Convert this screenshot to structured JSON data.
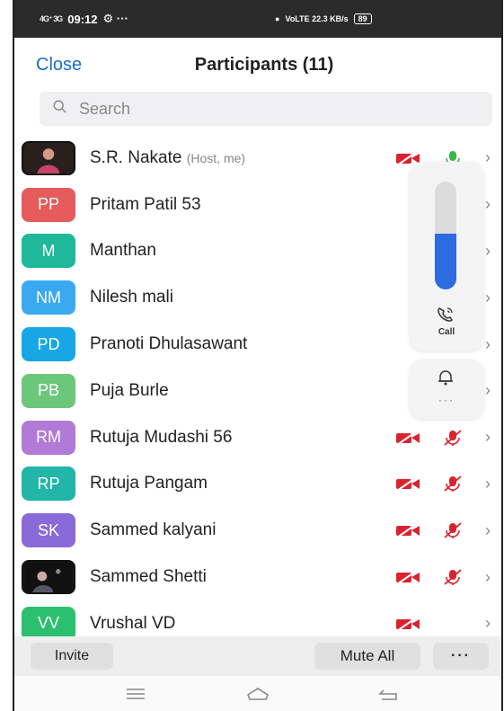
{
  "statusbar": {
    "signal_left": "4G⁺ 3G",
    "time": "09:12",
    "extra": "⚙ ···",
    "net_label": "VoLTE 22.3 KB/s",
    "battery": "89"
  },
  "header": {
    "close_label": "Close",
    "title": "Participants (11)"
  },
  "search": {
    "placeholder": "Search"
  },
  "participants": [
    {
      "initials": "",
      "name": "S.R. Nakate",
      "tag": "(Host, me)",
      "color": "#2a1f1f",
      "photo": true,
      "mic": "on"
    },
    {
      "initials": "PP",
      "name": "Pritam Patil 53",
      "tag": "",
      "color": "#e65b5b"
    },
    {
      "initials": "M",
      "name": "Manthan",
      "tag": "",
      "color": "#1fb89a"
    },
    {
      "initials": "NM",
      "name": "Nilesh mali",
      "tag": "",
      "color": "#3aa9f0"
    },
    {
      "initials": "PD",
      "name": "Pranoti Dhulasawant",
      "tag": "",
      "color": "#19a6e6"
    },
    {
      "initials": "PB",
      "name": "Puja Burle",
      "tag": "",
      "color": "#6dc77b"
    },
    {
      "initials": "RM",
      "name": "Rutuja Mudashi 56",
      "tag": "",
      "color": "#b07ad6",
      "mic": "muted"
    },
    {
      "initials": "RP",
      "name": "Rutuja Pangam",
      "tag": "",
      "color": "#21b6a8",
      "mic": "muted"
    },
    {
      "initials": "SK",
      "name": "Sammed kalyani",
      "tag": "",
      "color": "#8a6ad8",
      "mic": "muted"
    },
    {
      "initials": "",
      "name": "Sammed Shetti",
      "tag": "",
      "color": "#1a1a1a",
      "photo": true,
      "mic": "muted"
    },
    {
      "initials": "VV",
      "name": "Vrushal VD",
      "tag": "",
      "color": "#2bbf6f",
      "mic": "none"
    }
  ],
  "overlay": {
    "volume_level": 0.52,
    "call_label": "Call",
    "more_label": "···"
  },
  "bottom": {
    "invite_label": "Invite",
    "mute_all_label": "Mute All",
    "more_label": "···"
  },
  "colors": {
    "accent": "#1b6ec2",
    "video_off": "#d9232e",
    "mic_on": "#3bb54a"
  },
  "icons": {
    "search": "search-icon",
    "video_off": "video-off-icon",
    "mic_on": "mic-on-icon",
    "mic_off": "mic-off-icon",
    "chevron": "chevron-right-icon",
    "call": "phone-call-icon",
    "bell": "bell-icon",
    "nav_recent": "recent-apps-icon",
    "nav_home": "home-icon",
    "nav_back": "back-icon"
  }
}
